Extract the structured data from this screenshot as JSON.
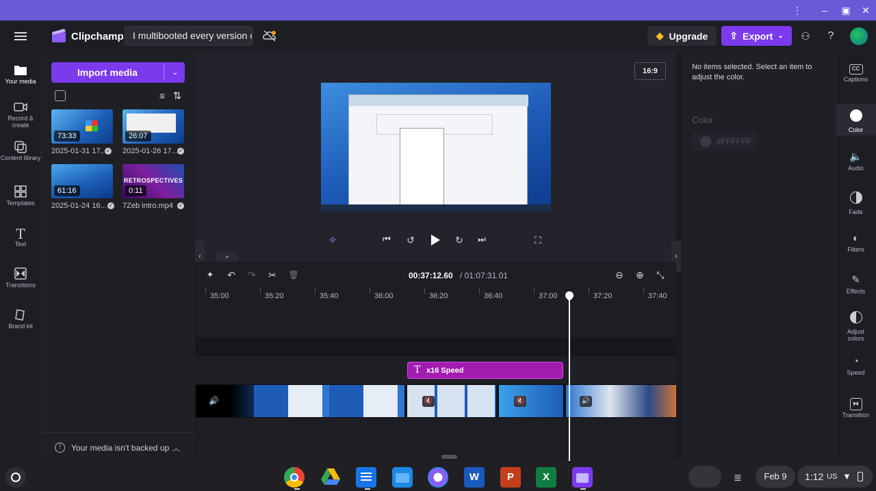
{
  "app": {
    "name": "Clipchamp",
    "project_title": "I multibooted every version of Windows",
    "upgrade_label": "Upgrade",
    "export_label": "Export"
  },
  "left_nav": [
    {
      "label": "Your media"
    },
    {
      "label": "Record & create"
    },
    {
      "label": "Content library"
    },
    {
      "label": "Templates"
    },
    {
      "label": "Text"
    },
    {
      "label": "Transitions"
    },
    {
      "label": "Brand kit"
    }
  ],
  "media": {
    "import_label": "Import media",
    "items": [
      {
        "duration": "73:33",
        "name": "2025-01-31 17..."
      },
      {
        "duration": "26:07",
        "name": "2025-01-26 17..."
      },
      {
        "duration": "61:16",
        "name": "2025-01-24 16..."
      },
      {
        "duration": "0:11",
        "name": "7Zeb intro.mp4",
        "overlay": "RETROSPECTIVES"
      }
    ],
    "backup_notice": "Your media isn't backed up"
  },
  "preview": {
    "aspect_ratio": "16:9"
  },
  "timeline": {
    "current_time": "00:37:12.60",
    "total_time": "/ 01:07:31.01",
    "ruler": [
      "35:00",
      "35:20",
      "35:40",
      "36:00",
      "36:20",
      "36:40",
      "37:00",
      "37:20",
      "37:40"
    ],
    "text_clip": "x16 Speed"
  },
  "right_panel": {
    "message": "No items selected. Select an item to adjust the color.",
    "color_label": "Color",
    "color_value": "#FFFFFF"
  },
  "right_nav": [
    {
      "label": "Captions"
    },
    {
      "label": "Color"
    },
    {
      "label": "Audio"
    },
    {
      "label": "Fade"
    },
    {
      "label": "Filters"
    },
    {
      "label": "Effects"
    },
    {
      "label": "Adjust colors"
    },
    {
      "label": "Speed"
    },
    {
      "label": "Transition"
    }
  ],
  "taskbar": {
    "date": "Feb 9",
    "time": "1:12",
    "locale": "US"
  },
  "colors": {
    "accent": "#7c3aed",
    "titlebar": "#6b5ad8",
    "text_clip": "#a21caf"
  }
}
